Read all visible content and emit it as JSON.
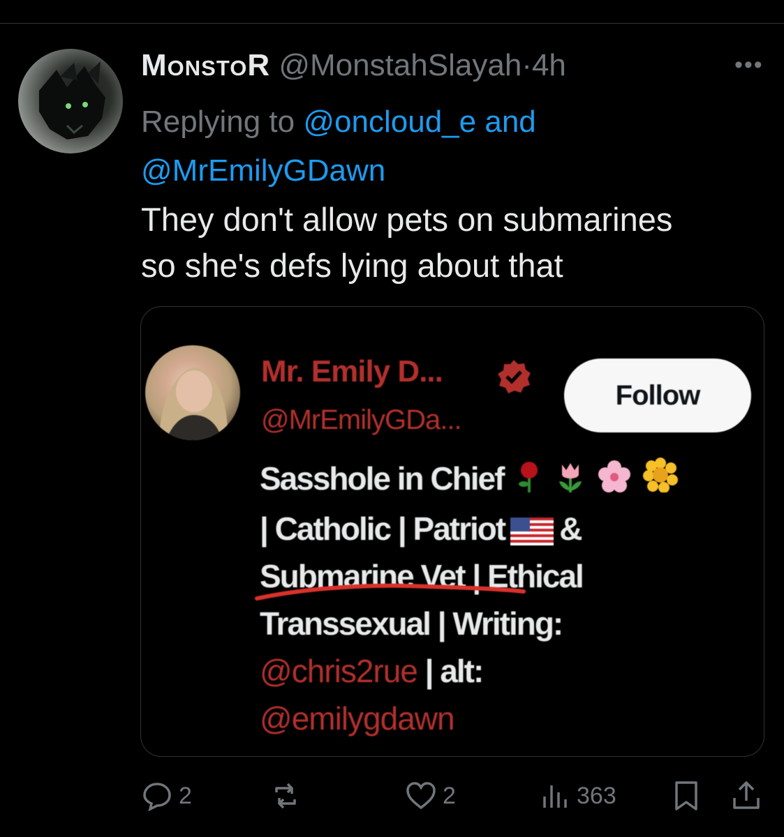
{
  "tweet": {
    "author_name": "MonstoR",
    "author_handle": "@MonstahSlayah",
    "separator": "·",
    "time": "4h",
    "more_label": "•••",
    "replying_prefix": "Replying to",
    "reply_to_1": "@oncloud_e",
    "reply_and": "and",
    "reply_to_2": "@MrEmilyGDawn",
    "text_line_1": "They don't allow pets on submarines",
    "text_line_2": "so she's defs lying about that"
  },
  "card": {
    "name": "Mr. Emily D...",
    "handle": "@MrEmilyGDa...",
    "follow_label": "Follow",
    "bio_line_1": "Sasshole in Chief",
    "bio_line_2a": "| Catholic | Patriot",
    "bio_line_2b": "&",
    "bio_line_3": "Submarine Vet | Ethical",
    "bio_line_4": "Transsexual | Writing:",
    "bio_mention_1": "@chris2rue",
    "bio_line_5": " | alt:",
    "bio_mention_2": "@emilygdawn",
    "underline_color": "#d8322b"
  },
  "actions": {
    "replies": "2",
    "reposts": "",
    "likes": "2",
    "views": "363"
  },
  "colors": {
    "background": "#000000",
    "link": "#1d9bf0",
    "muted": "#71767b",
    "card_red": "#b2302c"
  }
}
